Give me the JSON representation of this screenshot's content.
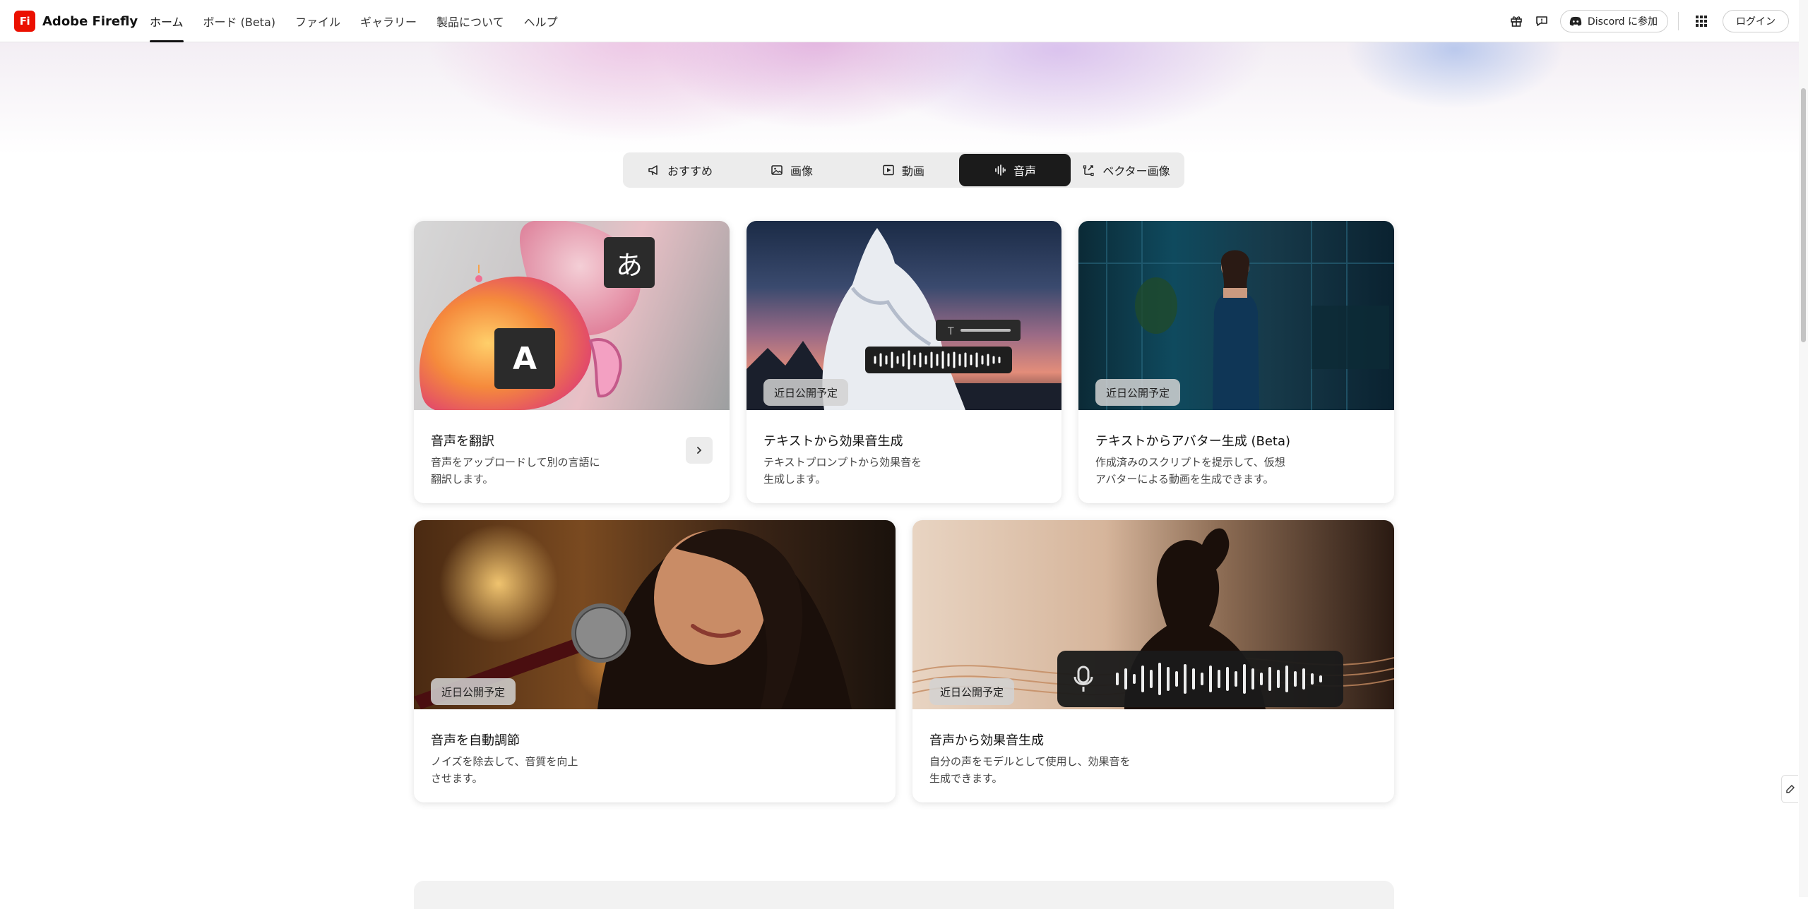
{
  "header": {
    "logo_mark": "Fi",
    "brand": "Adobe Firefly",
    "nav": [
      {
        "label": "ホーム",
        "active": true
      },
      {
        "label": "ボード (Beta)",
        "active": false
      },
      {
        "label": "ファイル",
        "active": false
      },
      {
        "label": "ギャラリー",
        "active": false
      },
      {
        "label": "製品について",
        "active": false
      },
      {
        "label": "ヘルプ",
        "active": false
      }
    ],
    "discord_label": "Discord に参加",
    "login_label": "ログイン",
    "icons": [
      "gift-icon",
      "feedback-icon",
      "discord-icon",
      "apps-grid-icon"
    ]
  },
  "tabs": [
    {
      "label": "おすすめ",
      "icon": "megaphone-icon",
      "active": false
    },
    {
      "label": "画像",
      "icon": "image-icon",
      "active": false
    },
    {
      "label": "動画",
      "icon": "video-icon",
      "active": false
    },
    {
      "label": "音声",
      "icon": "audio-wave-icon",
      "active": true
    },
    {
      "label": "ベクター画像",
      "icon": "vector-icon",
      "active": false
    }
  ],
  "cards": [
    {
      "title": "音声を翻訳",
      "desc_line1": "音声をアップロードして別の言語に",
      "desc_line2": "翻訳します。",
      "badge": "",
      "image_glyph_a": "あ",
      "image_glyph_b": "A"
    },
    {
      "title": "テキストから効果音生成",
      "desc_line1": "テキストプロンプトから効果音を",
      "desc_line2": "生成します。",
      "badge": "近日公開予定"
    },
    {
      "title": "テキストからアバター生成 (Beta)",
      "desc_line1": "作成済みのスクリプトを提示して、仮想",
      "desc_line2": "アバターによる動画を生成できます。",
      "badge": "近日公開予定"
    },
    {
      "title": "音声を自動調節",
      "desc_line1": "ノイズを除去して、音質を向上",
      "desc_line2": "させます。",
      "badge": "近日公開予定"
    },
    {
      "title": "音声から効果音生成",
      "desc_line1": "自分の声をモデルとして使用し、効果音を",
      "desc_line2": "生成できます。",
      "badge": "近日公開予定"
    }
  ],
  "colors": {
    "brand_red": "#eb1000",
    "active_tab": "#1b1b1b"
  }
}
